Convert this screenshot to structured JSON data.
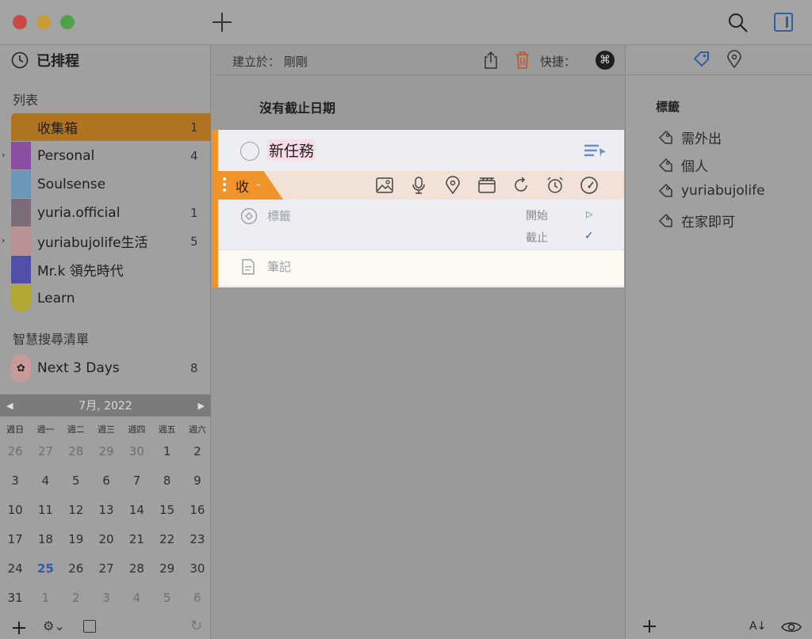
{
  "sidebar": {
    "scheduled_label": "已排程",
    "lists_title": "列表",
    "lists": [
      {
        "name": "收集箱",
        "count": "1",
        "color": "#b0731f",
        "selected": true,
        "expandable": false
      },
      {
        "name": "Personal",
        "count": "4",
        "color": "#8a4fa0",
        "expandable": true
      },
      {
        "name": "Soulsense",
        "count": "",
        "color": "#6b97b8",
        "expandable": false
      },
      {
        "name": "yuria.official",
        "count": "1",
        "color": "#7d6c7a",
        "expandable": false
      },
      {
        "name": "yuriabujolife生活",
        "count": "5",
        "color": "#b89297",
        "expandable": true
      },
      {
        "name": "Mr.k 領先時代",
        "count": "",
        "color": "#5050a8",
        "expandable": false
      },
      {
        "name": "Learn",
        "count": "",
        "color": "#b2a834",
        "expandable": false
      }
    ],
    "smart_title": "智慧搜尋清單",
    "smart_lists": [
      {
        "name": "Next 3 Days",
        "count": "8"
      }
    ]
  },
  "calendar": {
    "month_label": "7月, 2022",
    "weekdays": [
      "週日",
      "週一",
      "週二",
      "週三",
      "週四",
      "週五",
      "週六"
    ],
    "weeks": [
      [
        "26",
        "27",
        "28",
        "29",
        "30",
        "1",
        "2"
      ],
      [
        "3",
        "4",
        "5",
        "6",
        "7",
        "8",
        "9"
      ],
      [
        "10",
        "11",
        "12",
        "13",
        "14",
        "15",
        "16"
      ],
      [
        "17",
        "18",
        "19",
        "20",
        "21",
        "22",
        "23"
      ],
      [
        "24",
        "25",
        "26",
        "27",
        "28",
        "29",
        "30"
      ],
      [
        "31",
        "1",
        "2",
        "3",
        "4",
        "5",
        "6"
      ]
    ],
    "today": "25"
  },
  "main": {
    "created_label": "建立於： 剛剛",
    "shortcut_label": "快捷：",
    "section_title": "沒有截止日期",
    "task": {
      "title": "新任務",
      "list_tag": "收",
      "tags_placeholder": "標籤",
      "start_label": "開始",
      "due_label": "截止",
      "notes_placeholder": "筆記"
    }
  },
  "right_panel": {
    "title": "標籤",
    "tags": [
      "需外出",
      "個人",
      "yuriabujolife",
      "在家即可"
    ]
  },
  "colors": {
    "accent_orange": "#f0932b",
    "accent_blue": "#2d5fa8",
    "start_green": "#3aa04a"
  }
}
